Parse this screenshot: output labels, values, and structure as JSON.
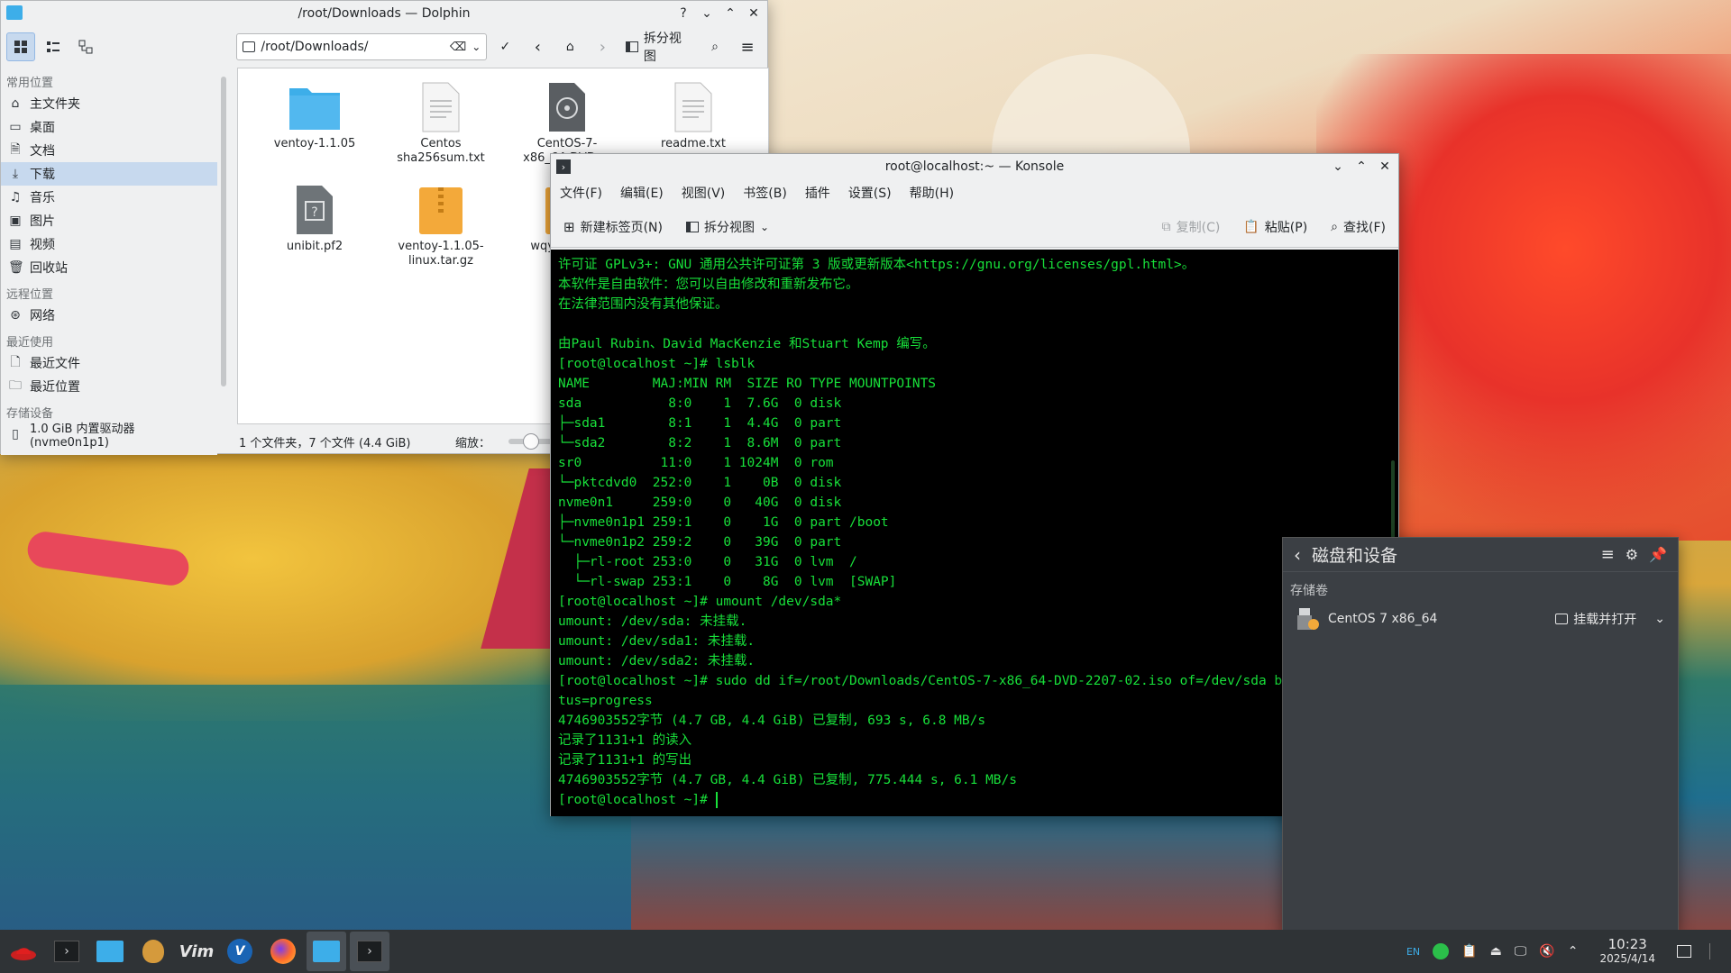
{
  "dolphin": {
    "title": "/root/Downloads — Dolphin",
    "location": "/root/Downloads/",
    "split_view_label": "拆分视图",
    "sidebar": {
      "sections": [
        {
          "title": "常用位置",
          "items": [
            {
              "label": "主文件夹",
              "icon": "home-icon"
            },
            {
              "label": "桌面",
              "icon": "desktop-icon"
            },
            {
              "label": "文档",
              "icon": "document-icon"
            },
            {
              "label": "下载",
              "icon": "download-icon",
              "selected": true
            },
            {
              "label": "音乐",
              "icon": "music-icon"
            },
            {
              "label": "图片",
              "icon": "picture-icon"
            },
            {
              "label": "视频",
              "icon": "video-icon"
            },
            {
              "label": "回收站",
              "icon": "trash-icon"
            }
          ]
        },
        {
          "title": "远程位置",
          "items": [
            {
              "label": "网络",
              "icon": "network-icon"
            }
          ]
        },
        {
          "title": "最近使用",
          "items": [
            {
              "label": "最近文件",
              "icon": "recent-files-icon"
            },
            {
              "label": "最近位置",
              "icon": "recent-locations-icon"
            }
          ]
        },
        {
          "title": "存储设备",
          "items": [
            {
              "label": "1.0 GiB 内置驱动器 (nvme0n1p1)",
              "icon": "drive-icon"
            }
          ]
        }
      ]
    },
    "files": [
      {
        "name": "ventoy-1.1.05",
        "type": "folder"
      },
      {
        "name": "Centos sha256sum.txt",
        "type": "text"
      },
      {
        "name": "CentOS-7-x86_64-DVD-...",
        "type": "iso"
      },
      {
        "name": "readme.txt",
        "type": "text"
      },
      {
        "name": "unibit.pf2",
        "type": "unknown"
      },
      {
        "name": "ventoy-1.1.05-linux.tar.gz",
        "type": "archive"
      },
      {
        "name": "wqy-u... 0-...",
        "type": "archive"
      }
    ],
    "status_text": "1 个文件夹，7 个文件 (4.4 GiB)",
    "zoom_label": "缩放："
  },
  "konsole": {
    "title": "root@localhost:~ — Konsole",
    "menu": [
      "文件(F)",
      "编辑(E)",
      "视图(V)",
      "书签(B)",
      "插件",
      "设置(S)",
      "帮助(H)"
    ],
    "toolbar": {
      "new_tab": "新建标签页(N)",
      "split_view": "拆分视图",
      "copy": "复制(C)",
      "paste": "粘贴(P)",
      "find": "查找(F)"
    },
    "lines": [
      "许可证 GPLv3+: GNU 通用公共许可证第 3 版或更新版本<https://gnu.org/licenses/gpl.html>。",
      "本软件是自由软件：您可以自由修改和重新发布它。",
      "在法律范围内没有其他保证。",
      "",
      "由Paul Rubin、David MacKenzie 和Stuart Kemp 编写。",
      "[root@localhost ~]# lsblk",
      "NAME        MAJ:MIN RM  SIZE RO TYPE MOUNTPOINTS",
      "sda           8:0    1  7.6G  0 disk",
      "├─sda1        8:1    1  4.4G  0 part",
      "└─sda2        8:2    1  8.6M  0 part",
      "sr0          11:0    1 1024M  0 rom",
      "└─pktcdvd0  252:0    1    0B  0 disk",
      "nvme0n1     259:0    0   40G  0 disk",
      "├─nvme0n1p1 259:1    0    1G  0 part /boot",
      "└─nvme0n1p2 259:2    0   39G  0 part",
      "  ├─rl-root 253:0    0   31G  0 lvm  /",
      "  └─rl-swap 253:1    0    8G  0 lvm  [SWAP]",
      "[root@localhost ~]# umount /dev/sda*",
      "umount: /dev/sda: 未挂载.",
      "umount: /dev/sda1: 未挂载.",
      "umount: /dev/sda2: 未挂载.",
      "[root@localhost ~]# sudo dd if=/root/Downloads/CentOS-7-x86_64-DVD-2207-02.iso of=/dev/sda bs=4M sta",
      "tus=progress",
      "4746903552字节 (4.7 GB, 4.4 GiB) 已复制, 693 s, 6.8 MB/s",
      "记录了1131+1 的读入",
      "记录了1131+1 的写出",
      "4746903552字节 (4.7 GB, 4.4 GiB) 已复制, 775.444 s, 6.1 MB/s",
      "[root@localhost ~]# "
    ]
  },
  "devices_panel": {
    "title": "磁盘和设备",
    "section": "存储卷",
    "device_name": "CentOS 7 x86_64",
    "action_label": "挂载并打开"
  },
  "taskbar": {
    "lang": "EN",
    "time": "10:23",
    "date": "2025/4/14"
  }
}
